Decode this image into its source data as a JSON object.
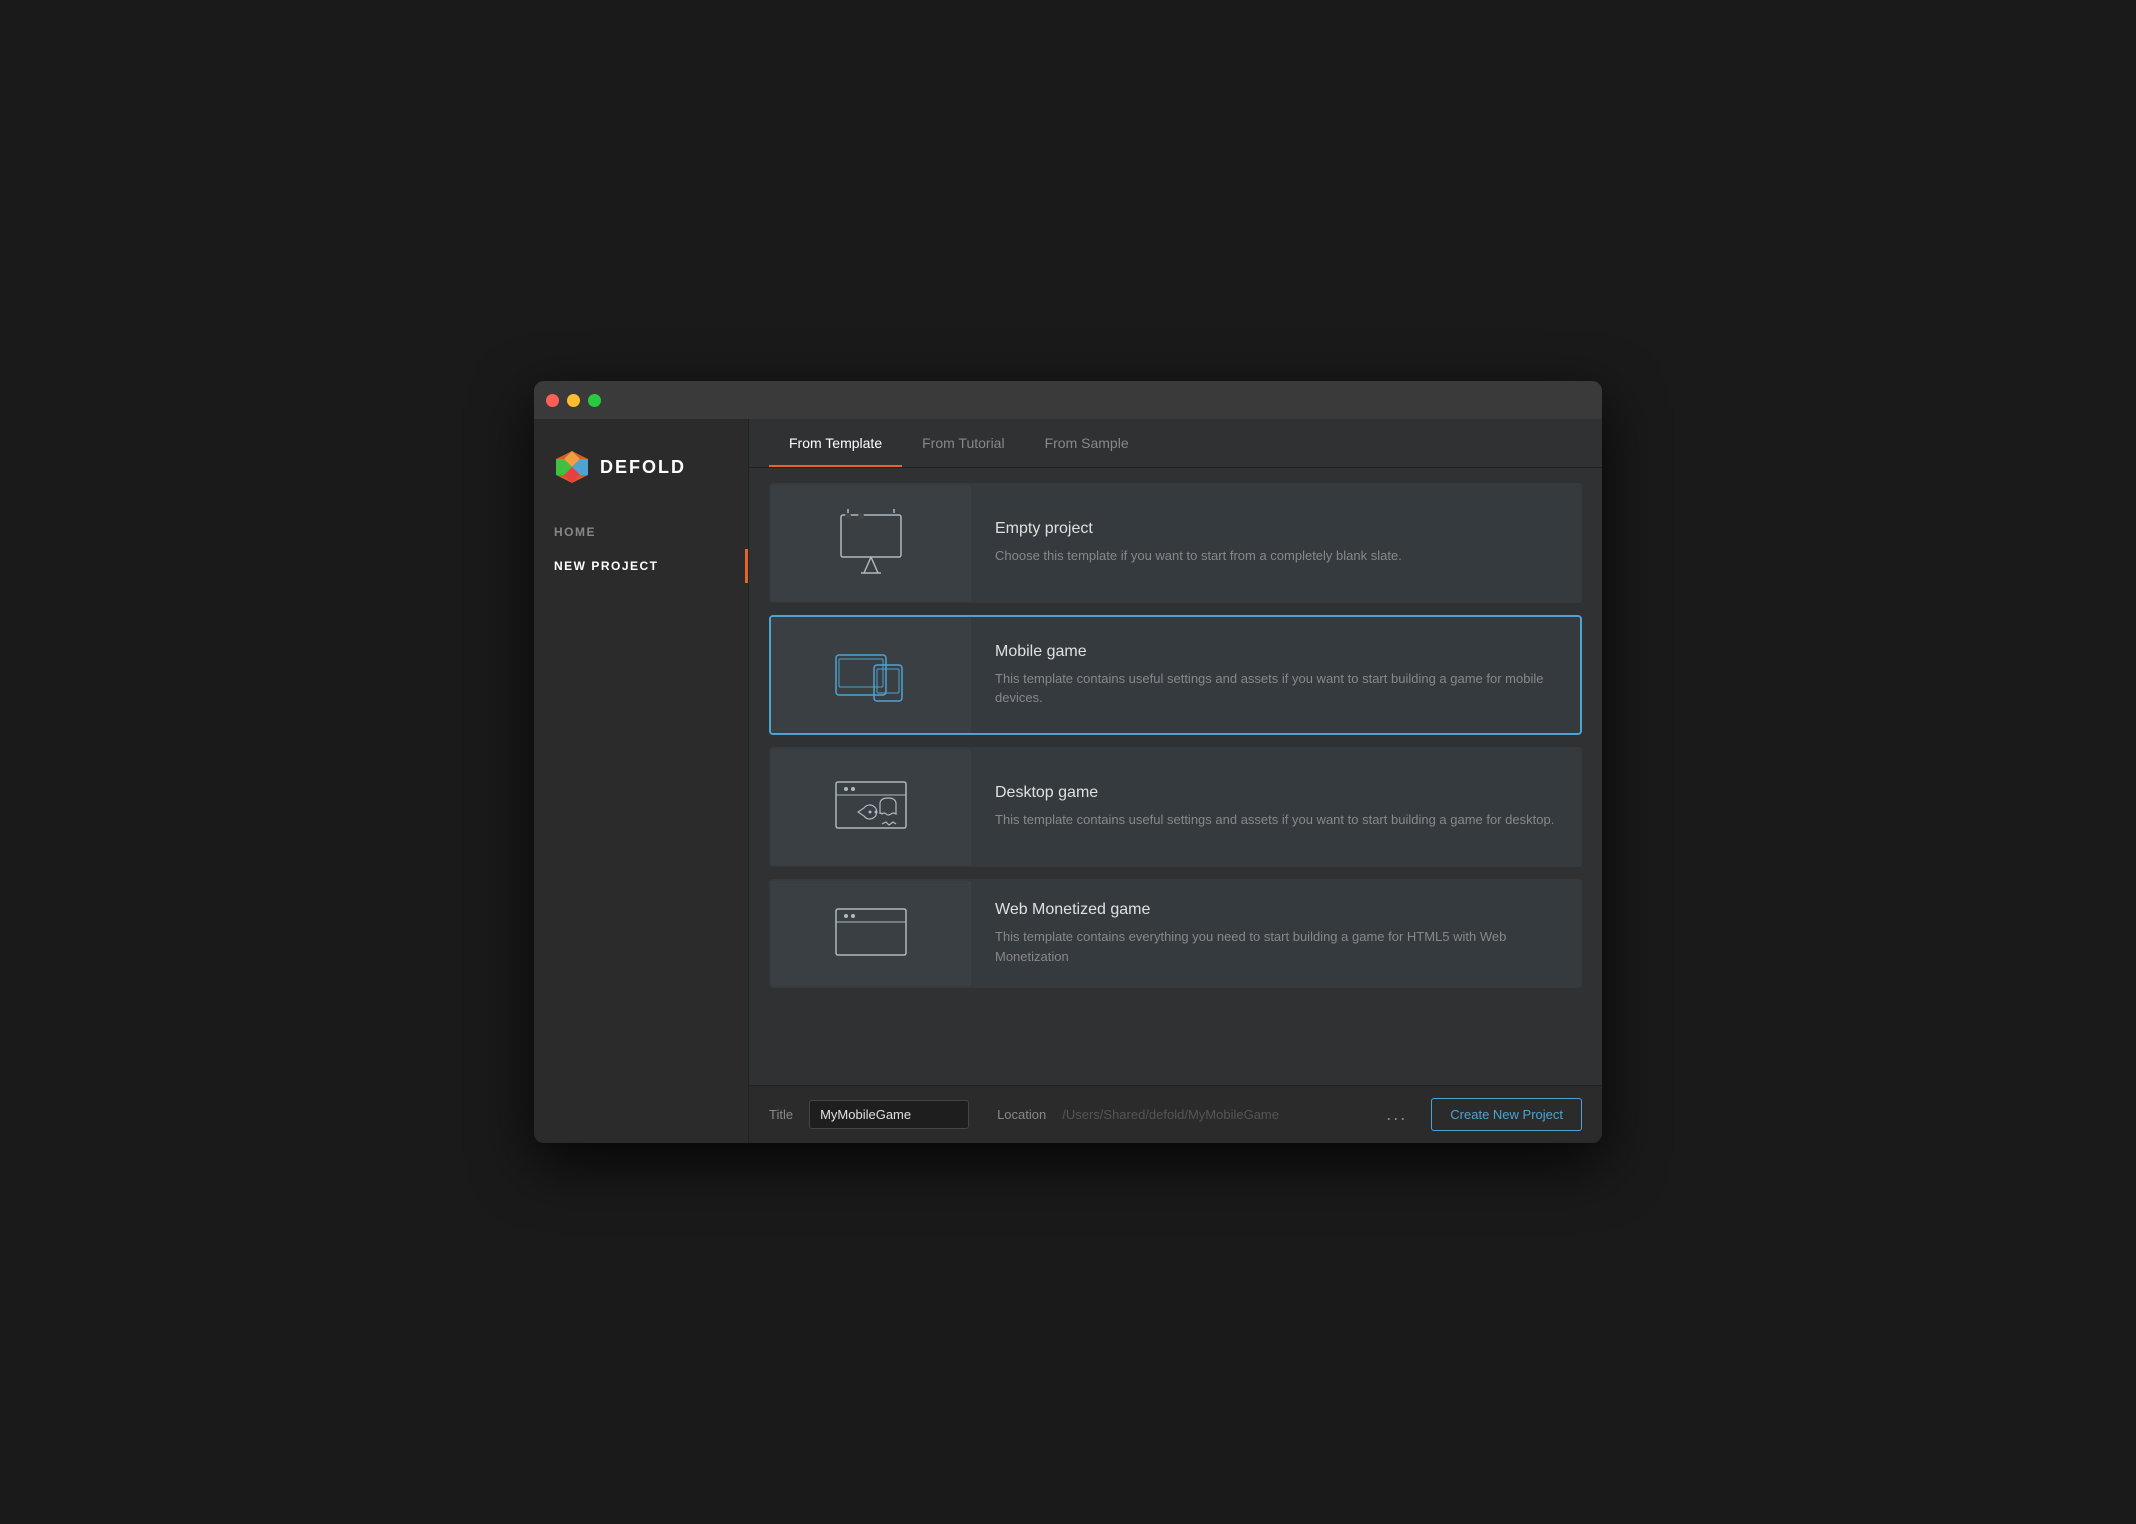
{
  "window": {
    "titlebar": {
      "traffic_lights": [
        "close",
        "minimize",
        "maximize"
      ]
    }
  },
  "sidebar": {
    "logo": "DEFOLD",
    "items": [
      {
        "id": "home",
        "label": "HOME",
        "active": false
      },
      {
        "id": "new-project",
        "label": "NEW PROJECT",
        "active": true
      }
    ]
  },
  "tabs": [
    {
      "id": "from-template",
      "label": "From Template",
      "active": true
    },
    {
      "id": "from-tutorial",
      "label": "From Tutorial",
      "active": false
    },
    {
      "id": "from-sample",
      "label": "From Sample",
      "active": false
    }
  ],
  "templates": [
    {
      "id": "empty",
      "name": "Empty project",
      "description": "Choose this template if you want to start from a completely blank slate.",
      "selected": false,
      "icon": "easel"
    },
    {
      "id": "mobile",
      "name": "Mobile game",
      "description": "This template contains useful settings and assets if you want to start building a game for mobile devices.",
      "selected": true,
      "icon": "mobile"
    },
    {
      "id": "desktop",
      "name": "Desktop game",
      "description": "This template contains useful settings and assets if you want to start building a game for desktop.",
      "selected": false,
      "icon": "desktop"
    },
    {
      "id": "web",
      "name": "Web Monetized game",
      "description": "This template contains everything you need to start building a game for HTML5 with Web Monetization",
      "selected": false,
      "icon": "web"
    }
  ],
  "bottom_bar": {
    "title_label": "Title",
    "title_value": "MyMobileGame",
    "location_label": "Location",
    "location_path": "/Users/Shared/defold/",
    "location_suffix": "MyMobileGame",
    "ellipsis": "...",
    "create_button": "Create New Project"
  }
}
